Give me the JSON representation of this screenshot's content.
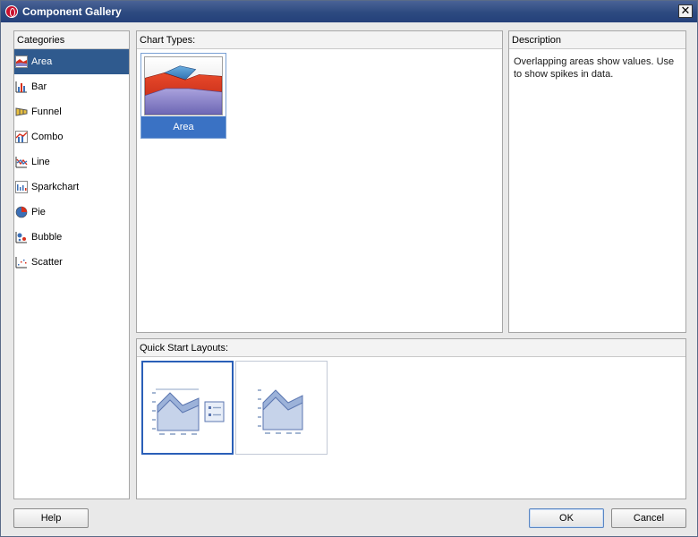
{
  "window": {
    "title": "Component Gallery",
    "close_label": "✕"
  },
  "categories": {
    "header": "Categories",
    "items": [
      {
        "label": "Area",
        "icon": "area-chart-icon",
        "selected": true
      },
      {
        "label": "Bar",
        "icon": "bar-chart-icon"
      },
      {
        "label": "Funnel",
        "icon": "funnel-chart-icon"
      },
      {
        "label": "Combo",
        "icon": "combo-chart-icon"
      },
      {
        "label": "Line",
        "icon": "line-chart-icon"
      },
      {
        "label": "Sparkchart",
        "icon": "sparkchart-icon"
      },
      {
        "label": "Pie",
        "icon": "pie-chart-icon"
      },
      {
        "label": "Bubble",
        "icon": "bubble-chart-icon"
      },
      {
        "label": "Scatter",
        "icon": "scatter-chart-icon"
      }
    ]
  },
  "chart_types": {
    "header": "Chart Types:",
    "items": [
      {
        "label": "Area",
        "selected": true
      }
    ]
  },
  "description": {
    "header": "Description",
    "text": "Overlapping areas show values. Use to show spikes in data."
  },
  "quick_start": {
    "header": "Quick Start Layouts:",
    "layouts": [
      {
        "selected": true,
        "legend": true
      },
      {
        "selected": false,
        "legend": false
      }
    ]
  },
  "buttons": {
    "help": "Help",
    "ok": "OK",
    "cancel": "Cancel"
  },
  "colors": {
    "titlebar": "#2d4a80",
    "selection": "#2f5a8e",
    "tile_label": "#3a72c4",
    "area_red": "#d8301c",
    "area_blue": "#4a8fc8",
    "area_purple": "#8a84c8"
  }
}
